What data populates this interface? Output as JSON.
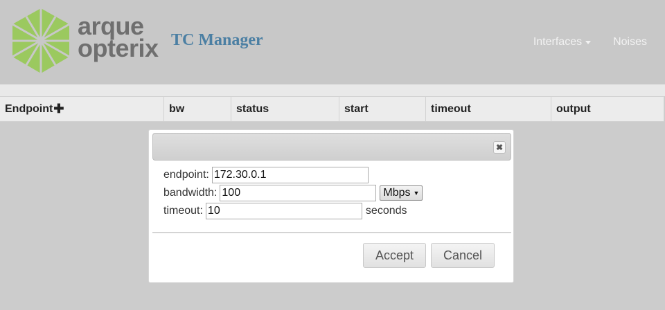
{
  "brand": {
    "logo_line1": "arque",
    "logo_line2": "opterix",
    "app_title": "TC Manager",
    "logo_color": "#8cc152"
  },
  "nav": {
    "items": [
      {
        "label": "Interfaces",
        "has_dropdown": true
      },
      {
        "label": "Noises",
        "has_dropdown": false
      }
    ]
  },
  "table": {
    "columns": [
      "Endpoint",
      "bw",
      "status",
      "start",
      "timeout",
      "output"
    ],
    "add_icon": "plus-icon"
  },
  "dialog": {
    "close_icon": "close-icon",
    "fields": {
      "endpoint": {
        "label": "endpoint:",
        "value": "172.30.0.1"
      },
      "bandwidth": {
        "label": "bandwidth:",
        "value": "100",
        "unit": "Mbps"
      },
      "timeout": {
        "label": "timeout:",
        "value": "10",
        "suffix": "seconds"
      }
    },
    "accept_label": "Accept",
    "cancel_label": "Cancel"
  }
}
